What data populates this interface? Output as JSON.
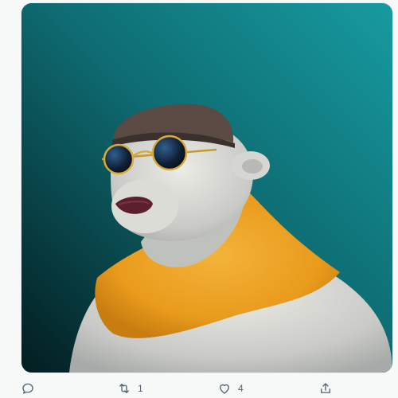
{
  "tweet": {
    "media": {
      "subject": "bear-character-artwork",
      "background_top": "#16969a",
      "background_bottom": "#06383d"
    },
    "actions": {
      "reply": {
        "icon": "reply-icon",
        "count": ""
      },
      "retweet": {
        "icon": "retweet-icon",
        "count": "1"
      },
      "like": {
        "icon": "heart-icon",
        "count": "4"
      },
      "share": {
        "icon": "share-icon",
        "count": ""
      }
    }
  }
}
